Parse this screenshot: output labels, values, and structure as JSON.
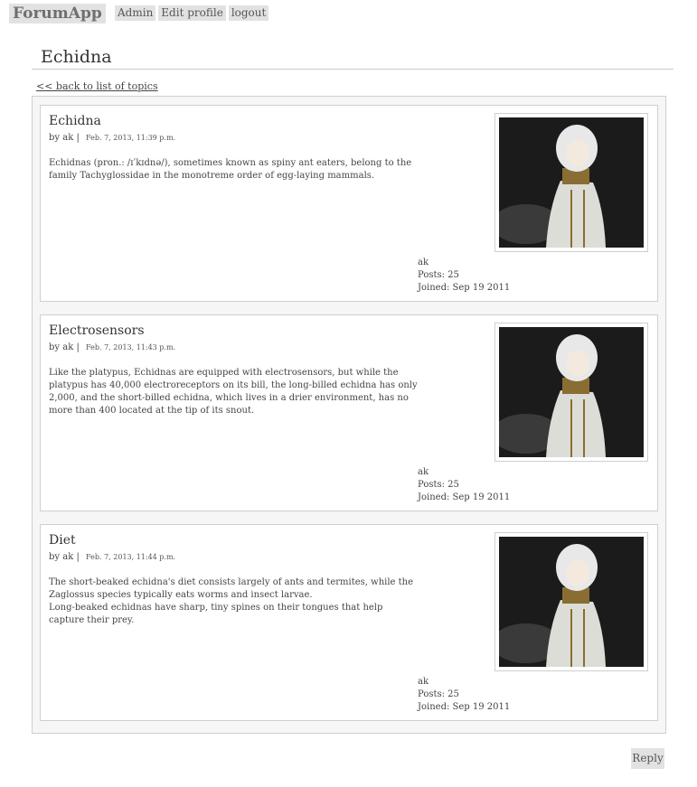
{
  "nav": {
    "brand": "ForumApp",
    "links": [
      "Admin",
      "Edit profile",
      "logout"
    ]
  },
  "page": {
    "title": "Echidna",
    "back_link": "<< back to list of topics",
    "reply_button": "Reply"
  },
  "posts": [
    {
      "title": "Echidna",
      "by_prefix": "by",
      "author": "ak",
      "separator": "|",
      "date": "Feb. 7, 2013, 11:39 p.m.",
      "body": [
        "Echidnas (pron.: /ɪˈkɪdnə/), sometimes known as spiny ant eaters, belong to the family Tachyglossidae in the monotreme order of egg-laying mammals."
      ],
      "author_name": "ak",
      "posts_count": "Posts: 25",
      "joined": "Joined: Sep 19 2011"
    },
    {
      "title": "Electrosensors",
      "by_prefix": "by",
      "author": "ak",
      "separator": "|",
      "date": "Feb. 7, 2013, 11:43 p.m.",
      "body": [
        "Like the platypus, Echidnas are equipped with electrosensors, but while the platypus has 40,000 electroreceptors on its bill, the long-billed echidna has only 2,000, and the short-billed echidna, which lives in a drier environment, has no more than 400 located at the tip of its snout."
      ],
      "author_name": "ak",
      "posts_count": "Posts: 25",
      "joined": "Joined: Sep 19 2011"
    },
    {
      "title": "Diet",
      "by_prefix": "by",
      "author": "ak",
      "separator": "|",
      "date": "Feb. 7, 2013, 11:44 p.m.",
      "body": [
        "The short-beaked echidna's diet consists largely of ants and termites, while the Zaglossus species typically eats worms and insect larvae.",
        "Long-beaked echidnas have sharp, tiny spines on their tongues that help capture their prey."
      ],
      "author_name": "ak",
      "posts_count": "Posts: 25",
      "joined": "Joined: Sep 19 2011"
    }
  ]
}
